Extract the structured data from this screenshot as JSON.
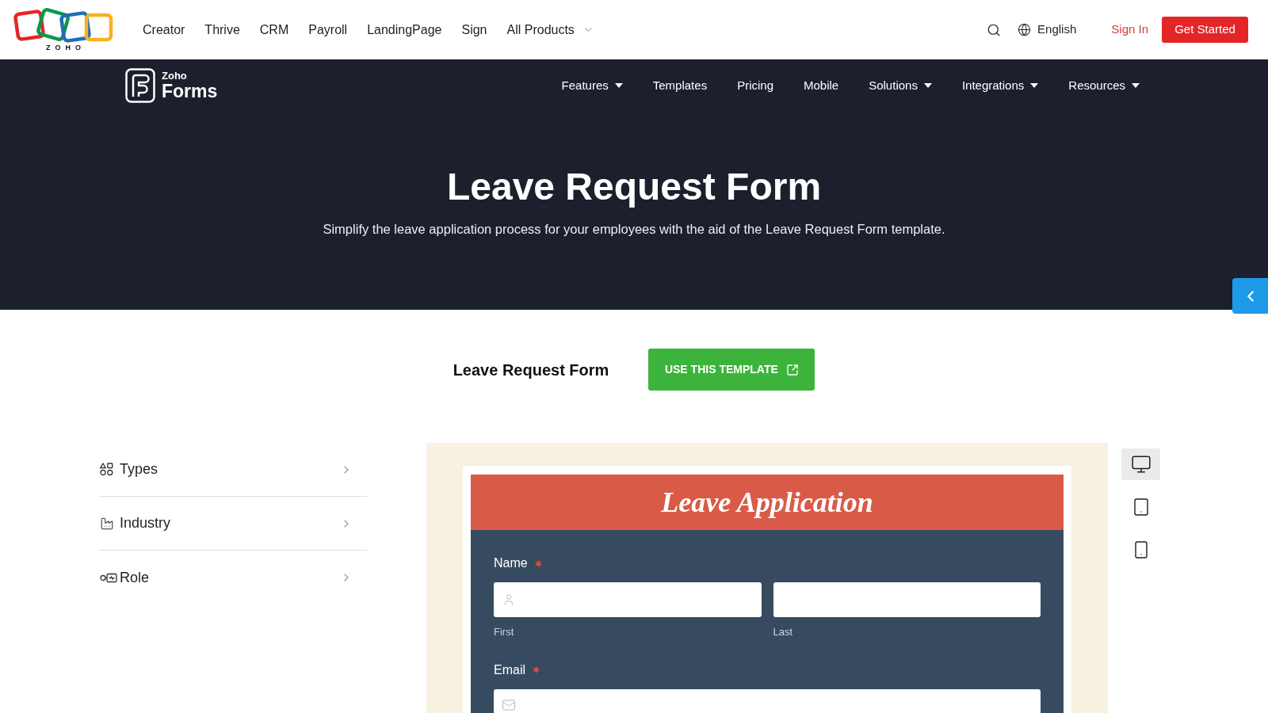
{
  "top_bar": {
    "logo_text": "ZOHO",
    "products": [
      {
        "label": "Creator",
        "dropdown": false
      },
      {
        "label": "Thrive",
        "dropdown": false
      },
      {
        "label": "CRM",
        "dropdown": false
      },
      {
        "label": "Payroll",
        "dropdown": false
      },
      {
        "label": "LandingPage",
        "dropdown": false
      },
      {
        "label": "Sign",
        "dropdown": false
      },
      {
        "label": "All Products",
        "dropdown": true
      }
    ],
    "language": "English",
    "sign_in": "Sign In",
    "get_started": "Get Started"
  },
  "site_header": {
    "brand_small": "Zoho",
    "brand_large": "Forms",
    "nav": [
      {
        "label": "Features",
        "dropdown": true
      },
      {
        "label": "Templates",
        "dropdown": false
      },
      {
        "label": "Pricing",
        "dropdown": false
      },
      {
        "label": "Mobile",
        "dropdown": false
      },
      {
        "label": "Solutions",
        "dropdown": true
      },
      {
        "label": "Integrations",
        "dropdown": true
      },
      {
        "label": "Resources",
        "dropdown": true
      }
    ]
  },
  "hero": {
    "title": "Leave Request Form",
    "subtitle": "Simplify the leave application process for your employees with the aid of the Leave Request Form template."
  },
  "template_bar": {
    "name": "Leave Request Form",
    "button": "USE THIS TEMPLATE"
  },
  "categories": [
    {
      "label": "Types"
    },
    {
      "label": "Industry"
    },
    {
      "label": "Role"
    }
  ],
  "preview": {
    "form_title": "Leave Application",
    "fields": [
      {
        "kind": "name",
        "label": "Name",
        "required": true,
        "sublabels": [
          "First",
          "Last"
        ]
      },
      {
        "kind": "email",
        "label": "Email",
        "required": true
      }
    ]
  },
  "device_modes": [
    {
      "kind": "desktop",
      "selected": true
    },
    {
      "kind": "tablet",
      "selected": false
    },
    {
      "kind": "mobile",
      "selected": false
    }
  ]
}
